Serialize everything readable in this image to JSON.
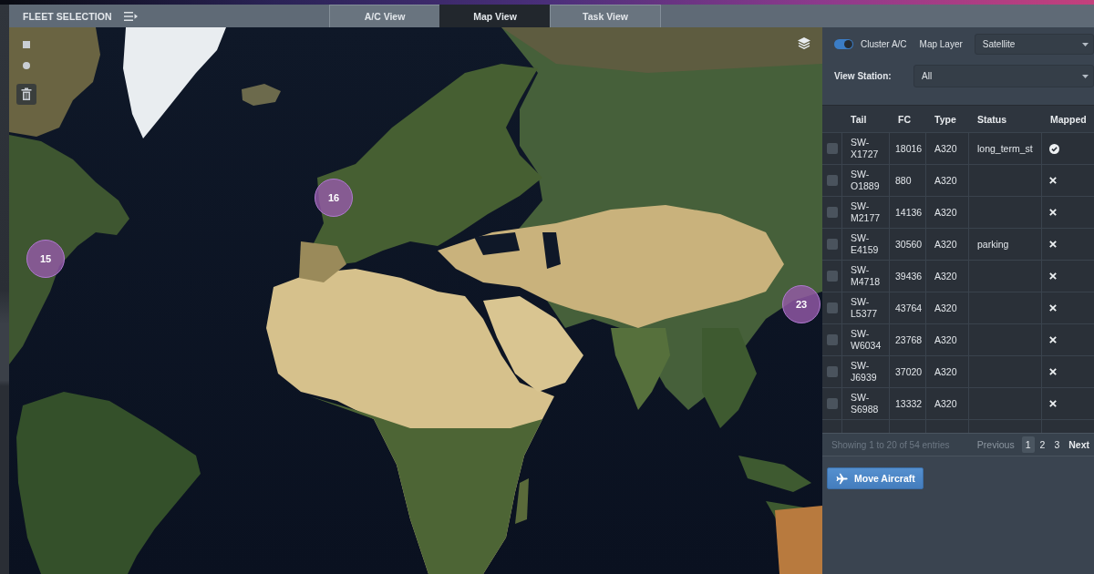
{
  "header": {
    "title": "FLEET SELECTION"
  },
  "tabs": [
    {
      "label": "A/C View",
      "selected": false
    },
    {
      "label": "Map View",
      "selected": true
    },
    {
      "label": "Task View",
      "selected": false
    }
  ],
  "map": {
    "clusters": [
      {
        "count": "15"
      },
      {
        "count": "16"
      },
      {
        "count": "23"
      }
    ]
  },
  "controls": {
    "cluster_toggle": {
      "label": "Cluster A/C",
      "on": true
    },
    "map_layer": {
      "label": "Map Layer",
      "value": "Satellite"
    },
    "view_station": {
      "label": "View Station:",
      "value": "All"
    }
  },
  "table": {
    "columns": [
      "Tail",
      "FC",
      "Type",
      "Status",
      "Mapped"
    ],
    "rows": [
      {
        "checked": false,
        "tail": "SW-X1727",
        "fc": "18016",
        "type": "A320",
        "status": "long_term_st",
        "mapped": true
      },
      {
        "checked": false,
        "tail": "SW-O1889",
        "fc": "880",
        "type": "A320",
        "mapped": false
      },
      {
        "checked": false,
        "tail": "SW-M2177",
        "fc": "14136",
        "type": "A320",
        "mapped": false
      },
      {
        "checked": false,
        "tail": "SW-E4159",
        "fc": "30560",
        "type": "A320",
        "status": "parking",
        "mapped": false
      },
      {
        "checked": false,
        "tail": "SW-M4718",
        "fc": "39436",
        "type": "A320",
        "mapped": false
      },
      {
        "checked": false,
        "tail": "SW-L5377",
        "fc": "43764",
        "type": "A320",
        "mapped": false
      },
      {
        "checked": false,
        "tail": "SW-W6034",
        "fc": "23768",
        "type": "A320",
        "mapped": false
      },
      {
        "checked": false,
        "tail": "SW-J6939",
        "fc": "37020",
        "type": "A320",
        "mapped": false
      },
      {
        "checked": false,
        "tail": "SW-S6988",
        "fc": "13332",
        "type": "A320",
        "mapped": false
      }
    ]
  },
  "pagination": {
    "info": "Showing 1 to 20 of 54 entries",
    "previous": {
      "label": "Previous",
      "disabled": true
    },
    "pages": [
      {
        "label": "1",
        "selected": true
      },
      {
        "label": "2",
        "selected": false
      },
      {
        "label": "3",
        "selected": false
      }
    ],
    "next": {
      "label": "Next",
      "disabled": false
    }
  },
  "actions": {
    "move_button": "Move Aircraft"
  }
}
